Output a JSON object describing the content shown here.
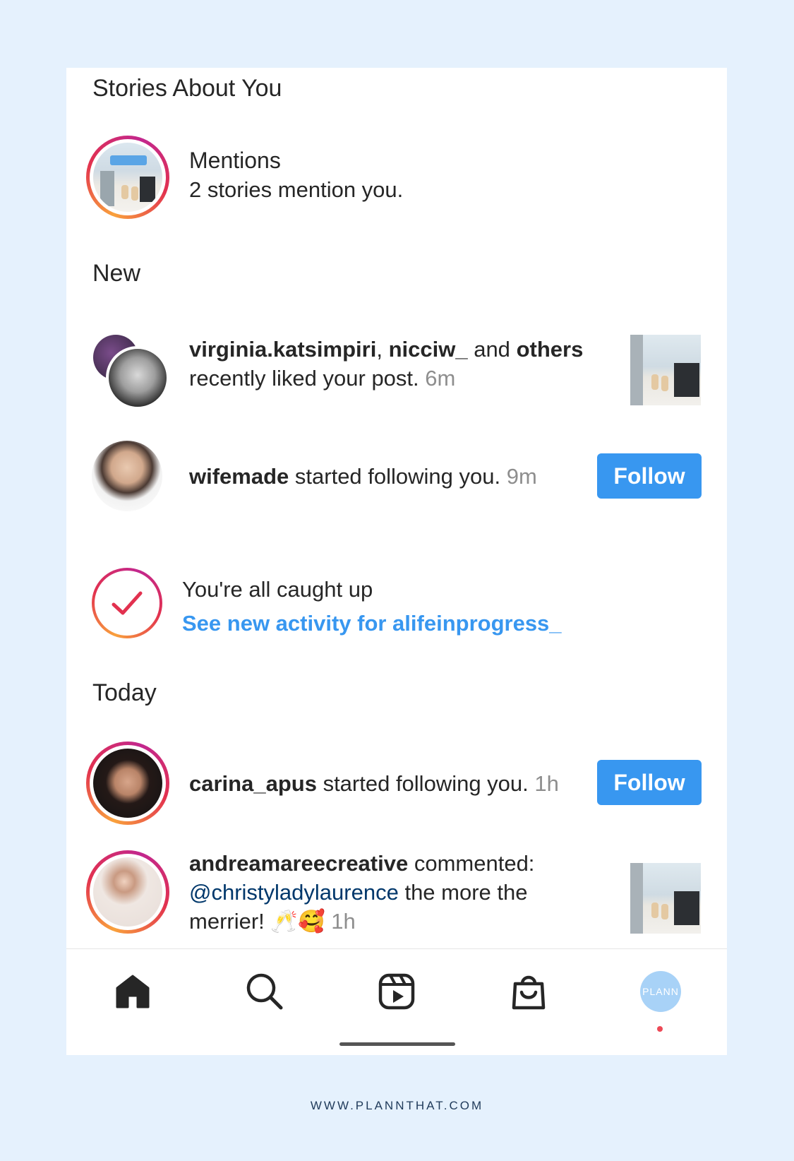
{
  "stories_section": {
    "title": "Stories About You",
    "mentions_title": "Mentions",
    "mentions_subtitle": "2 stories mention you."
  },
  "new_section": {
    "title": "New",
    "likes": {
      "user1": "virginia.katsimpiri",
      "sep": ",",
      "user2": "nicciw_",
      "and": "and",
      "others": "others",
      "action": "recently liked your post.",
      "time": "6m"
    },
    "follow1": {
      "user": "wifemade",
      "action": "started following you.",
      "time": "9m",
      "button": "Follow"
    }
  },
  "caught_up": {
    "title": "You're all caught up",
    "link": "See new activity for alifeinprogress_"
  },
  "today_section": {
    "title": "Today",
    "follow2": {
      "user": "carina_apus",
      "action": "started following you.",
      "time": "1h",
      "button": "Follow"
    },
    "comment": {
      "user": "andreamareecreative",
      "action": "commented:",
      "mention": "@christyladylaurence",
      "text1": "the more the",
      "text2": "merrier!",
      "emoji": "🥂🥰",
      "time": "1h"
    }
  },
  "nav": {
    "profile_text": "PLANN",
    "icons": [
      "home-icon",
      "search-icon",
      "reels-icon",
      "shop-icon",
      "profile-avatar"
    ]
  },
  "footer": "WWW.PLANNTHAT.COM",
  "colors": {
    "background": "#e5f1fd",
    "follow_button": "#3897f0",
    "link": "#3897f0",
    "mention": "#00376b",
    "notification_dot": "#ed4956"
  }
}
